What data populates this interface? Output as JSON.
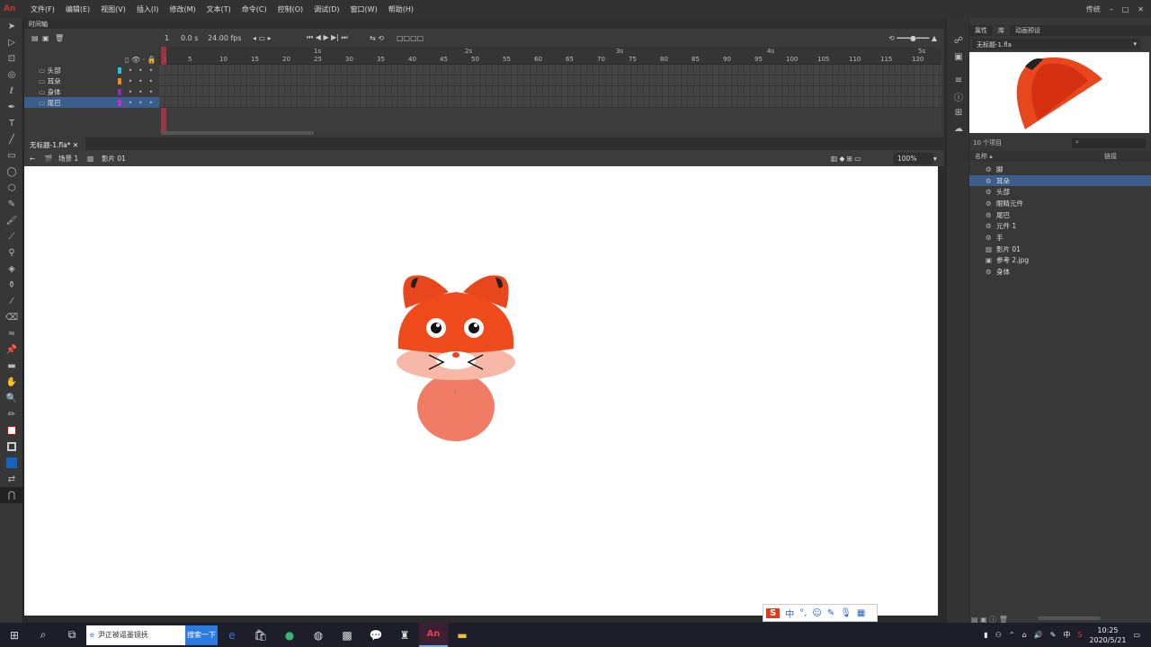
{
  "app": {
    "logo": "An",
    "workspace": "传统"
  },
  "menu": [
    "文件(F)",
    "编辑(E)",
    "视图(V)",
    "插入(I)",
    "修改(M)",
    "文本(T)",
    "命令(C)",
    "控制(O)",
    "调试(D)",
    "窗口(W)",
    "帮助(H)"
  ],
  "timeline": {
    "tab": "时间轴",
    "frame": "1",
    "time": "0.0 s",
    "fps": "24.00 fps",
    "layers": [
      {
        "name": "头部",
        "color": "#1ec8c8",
        "selected": false
      },
      {
        "name": "耳朵",
        "color": "#e88a1e",
        "selected": false
      },
      {
        "name": "身体",
        "color": "#8a2fc0",
        "selected": false
      },
      {
        "name": "尾巴",
        "color": "#c02fd0",
        "selected": true
      }
    ],
    "ruler_frames": [
      "1",
      "5",
      "10",
      "15",
      "20",
      "25",
      "30",
      "35",
      "40",
      "45",
      "50",
      "55",
      "60",
      "65",
      "70",
      "75",
      "80",
      "85",
      "90",
      "95",
      "100",
      "105",
      "110",
      "115",
      "120"
    ],
    "ruler_seconds": [
      "1s",
      "2s",
      "3s",
      "4s",
      "5s"
    ]
  },
  "document": {
    "tab": "无标题-1.fla*",
    "scene": "场景 1",
    "symbol": "影片 01",
    "zoom": "100%"
  },
  "panel": {
    "tabs": [
      "属性",
      "库",
      "动画预设"
    ],
    "file": "无标题-1.fla",
    "item_count": "10 个项目",
    "col_name": "名称",
    "col_link": "链接",
    "library_items": [
      {
        "name": "脚",
        "icon": "symbol",
        "selected": false
      },
      {
        "name": "耳朵",
        "icon": "symbol",
        "selected": true
      },
      {
        "name": "头部",
        "icon": "symbol",
        "selected": false
      },
      {
        "name": "眼睛元件",
        "icon": "symbol",
        "selected": false
      },
      {
        "name": "尾巴",
        "icon": "symbol",
        "selected": false
      },
      {
        "name": "元件 1",
        "icon": "symbol",
        "selected": false
      },
      {
        "name": "手",
        "icon": "symbol",
        "selected": false
      },
      {
        "name": "影片 01",
        "icon": "movieclip",
        "selected": false
      },
      {
        "name": "参考 2.jpg",
        "icon": "image",
        "selected": false
      },
      {
        "name": "身体",
        "icon": "symbol",
        "selected": false
      }
    ]
  },
  "taskbar": {
    "search_placeholder": "尹正被逼墨镜抚",
    "search_button": "搜索一下",
    "ime_lang": "中",
    "time": "10:25",
    "date": "2020/5/21"
  },
  "ime_bar": {
    "lang": "中"
  },
  "colors": {
    "accent": "#3b5e8c",
    "fox_orange": "#ee4a1c",
    "body": "#f07c66"
  }
}
